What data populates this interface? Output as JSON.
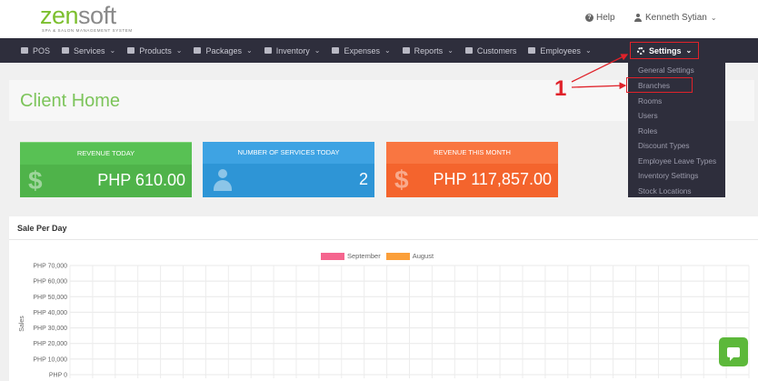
{
  "header": {
    "logo_zen": "zen",
    "logo_soft": "soft",
    "logo_tagline": "SPA & SALON MANAGEMENT SYSTEM",
    "help_label": "Help",
    "user_name": "Kenneth Sytian",
    "user_chevron": "⌄"
  },
  "nav": {
    "items": [
      {
        "label": "POS",
        "icon": "pos-icon"
      },
      {
        "label": "Services",
        "icon": "hand-icon",
        "dropdown": "⌄"
      },
      {
        "label": "Products",
        "icon": "cart-icon",
        "dropdown": "⌄"
      },
      {
        "label": "Packages",
        "icon": "tag-icon",
        "dropdown": "⌄"
      },
      {
        "label": "Inventory",
        "icon": "list-icon",
        "dropdown": "⌄"
      },
      {
        "label": "Expenses",
        "icon": "image-icon",
        "dropdown": "⌄"
      },
      {
        "label": "Reports",
        "icon": "bar-chart-icon",
        "dropdown": "⌄"
      },
      {
        "label": "Customers",
        "icon": "users-icon"
      },
      {
        "label": "Employees",
        "icon": "briefcase-icon",
        "dropdown": "⌄"
      }
    ],
    "settings_label": "Settings",
    "settings_chevron": "⌄"
  },
  "settings_menu": [
    "General Settings",
    "Branches",
    "Rooms",
    "Users",
    "Roles",
    "Discount Types",
    "Employee Leave Types",
    "Inventory Settings",
    "Stock Locations"
  ],
  "page": {
    "title": "Client Home"
  },
  "cards": [
    {
      "header": "REVENUE TODAY",
      "value": "PHP 610.00",
      "icon": "dollar-icon",
      "color": "#4fb34a"
    },
    {
      "header": "NUMBER OF SERVICES TODAY",
      "value": "2",
      "icon": "person-icon",
      "color": "#2e95d6"
    },
    {
      "header": "REVENUE THIS MONTH",
      "value": "PHP 117,857.00",
      "icon": "dollar-icon",
      "color": "#f4642d"
    }
  ],
  "sales_panel": {
    "title": "Sale Per Day"
  },
  "annotation": {
    "step_number": "1"
  },
  "chart_data": {
    "type": "bar",
    "title": "",
    "ylabel": "Sales",
    "xlabel": "",
    "ylim": [
      0,
      70000
    ],
    "yticks": [
      "PHP 70,000",
      "PHP 60,000",
      "PHP 50,000",
      "PHP 40,000",
      "PHP 30,000",
      "PHP 20,000",
      "PHP 10,000",
      "PHP 0"
    ],
    "legend_position": "top",
    "grid": true,
    "series": [
      {
        "name": "September",
        "color": "#f5658e"
      },
      {
        "name": "August",
        "color": "#fb9f3a"
      }
    ]
  }
}
